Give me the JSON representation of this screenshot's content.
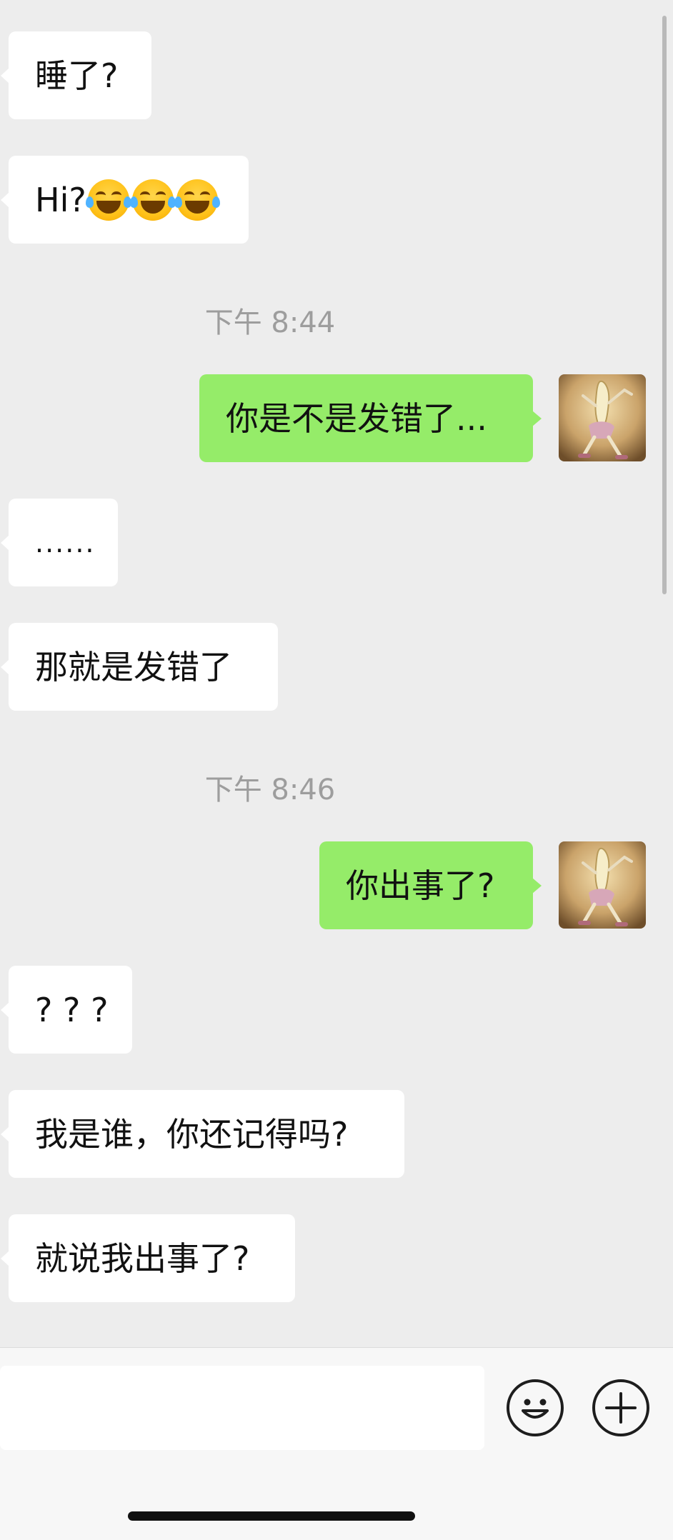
{
  "messages": [
    {
      "side": "in",
      "text": "睡了?"
    },
    {
      "side": "in",
      "text": "Hi?",
      "emoji": "face-with-tears-of-joy",
      "emoji_count": 3
    },
    {
      "type": "timestamp",
      "text": "下午 8:44"
    },
    {
      "side": "out",
      "text": "你是不是发错了..."
    },
    {
      "side": "in",
      "text": "......"
    },
    {
      "side": "in",
      "text": "那就是发错了"
    },
    {
      "type": "timestamp",
      "text": "下午 8:46"
    },
    {
      "side": "out",
      "text": "你出事了?"
    },
    {
      "side": "in",
      "text": "? ? ?"
    },
    {
      "side": "in",
      "text": "我是谁，你还记得吗?"
    },
    {
      "side": "in",
      "text": "就说我出事了?"
    }
  ],
  "input_bar": {
    "input_value": "",
    "emoji_button_icon": "smiley-face-icon",
    "plus_button_icon": "plus-circle-icon"
  },
  "colors": {
    "background": "#ededed",
    "incoming_bubble": "#ffffff",
    "outgoing_bubble": "#95ec69",
    "timestamp_text": "#9d9d9d"
  }
}
